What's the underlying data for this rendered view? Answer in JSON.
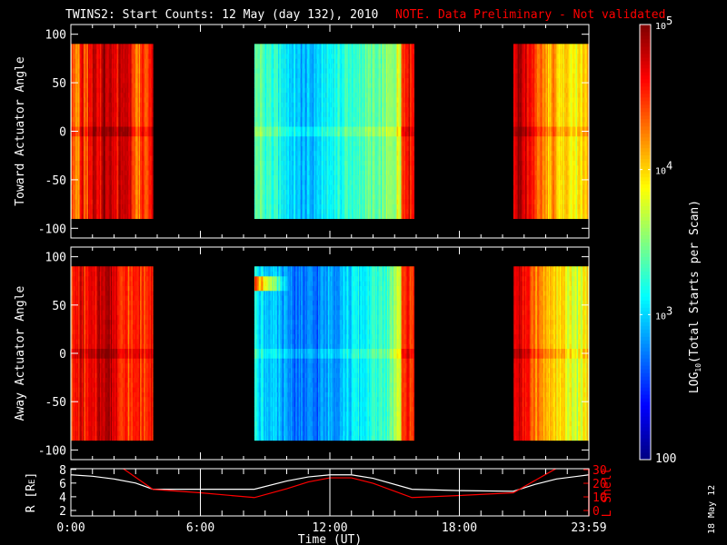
{
  "chart_data": {
    "type": "heatmap",
    "title": "TWINS2: Start Counts: 12 May (day 132), 2010",
    "note": "NOTE. Data Preliminary - Not validated",
    "colors": {
      "note": "#ff0000",
      "axis": "#ffffff",
      "lshell": "#ff0000",
      "r_line": "#ffffff"
    },
    "xlabel": "Time (UT)",
    "xlim_hours": [
      0,
      24
    ],
    "xticks": [
      {
        "h": 0,
        "label": "0:00"
      },
      {
        "h": 6,
        "label": "6:00"
      },
      {
        "h": 12,
        "label": "12:00"
      },
      {
        "h": 18,
        "label": "18:00"
      },
      {
        "h": 24,
        "label": "23:59"
      }
    ],
    "colorbar": {
      "label_prefix": "LOG",
      "label_sub": "10",
      "label_suffix": "(Total Starts per Scan)",
      "range_log": [
        2,
        5
      ],
      "ticks": [
        {
          "v": 2,
          "label": "100"
        },
        {
          "v": 3,
          "base": "10",
          "exp": "3"
        },
        {
          "v": 4,
          "base": "10",
          "exp": "4"
        },
        {
          "v": 5,
          "base": "10",
          "exp": "5"
        }
      ]
    },
    "panels": [
      {
        "ylabel": "Toward Actuator Angle",
        "ylim": [
          -110,
          110
        ],
        "yticks": [
          {
            "v": 100,
            "label": "100"
          },
          {
            "v": 50,
            "label": "50"
          },
          {
            "v": 0,
            "label": "0"
          },
          {
            "v": -50,
            "label": "-50"
          },
          {
            "v": -100,
            "label": "-100"
          }
        ],
        "angle_range": [
          -90,
          90
        ],
        "step_hours": 0.2,
        "blocks": [
          {
            "start": 0.0,
            "values": [
              4.4,
              4.2,
              4.6,
              4.3,
              4.6,
              4.8,
              4.7,
              4.9,
              4.8,
              4.7,
              4.6,
              4.8,
              4.9,
              4.7,
              4.5,
              4.3,
              4.6,
              4.4,
              4.7
            ]
          },
          {
            "start": 8.5,
            "values": [
              3.4,
              3.4,
              3.3,
              3.3,
              3.2,
              3.2,
              3.1,
              3.1,
              3.0,
              3.0,
              2.9,
              2.9,
              2.9,
              2.9,
              3.0,
              3.0,
              3.1,
              3.1,
              3.2,
              3.2,
              3.2,
              3.3,
              3.3,
              3.2,
              3.3,
              3.4,
              3.4,
              3.4,
              3.3,
              3.4,
              3.5,
              3.5,
              3.6,
              3.8,
              4.5,
              4.7,
              4.6
            ]
          },
          {
            "start": 20.5,
            "values": [
              4.8,
              4.9,
              4.7,
              4.6,
              4.5,
              4.4,
              4.3,
              4.2,
              4.1,
              4.2,
              4.0,
              3.9,
              4.0,
              3.9,
              3.8,
              3.9,
              4.0,
              4.1
            ]
          }
        ]
      },
      {
        "ylabel": "Away Actuator Angle",
        "ylim": [
          -110,
          110
        ],
        "yticks": [
          {
            "v": 100,
            "label": "100"
          },
          {
            "v": 50,
            "label": "50"
          },
          {
            "v": 0,
            "label": "0"
          },
          {
            "v": -50,
            "label": "-50"
          },
          {
            "v": -100,
            "label": "-100"
          }
        ],
        "angle_range": [
          -90,
          90
        ],
        "step_hours": 0.2,
        "blocks": [
          {
            "start": 0.0,
            "values": [
              4.5,
              4.6,
              4.7,
              4.5,
              4.6,
              4.7,
              4.8,
              4.9,
              4.9,
              4.8,
              4.7,
              4.6,
              4.5,
              4.4,
              4.5,
              4.6,
              4.5,
              4.4,
              4.6
            ]
          },
          {
            "start": 8.5,
            "values": [
              3.2,
              3.1,
              3.0,
              3.0,
              2.9,
              2.9,
              2.8,
              2.8,
              2.8,
              2.7,
              2.7,
              2.7,
              2.7,
              2.7,
              2.7,
              2.8,
              2.8,
              2.9,
              2.9,
              2.9,
              3.0,
              3.0,
              3.0,
              3.1,
              3.1,
              3.1,
              3.2,
              3.2,
              3.2,
              3.3,
              3.3,
              3.4,
              3.5,
              3.8,
              4.4,
              4.6,
              4.5
            ]
          },
          {
            "start": 20.5,
            "values": [
              4.7,
              4.8,
              4.6,
              4.5,
              4.4,
              4.3,
              4.2,
              4.1,
              4.0,
              4.0,
              3.9,
              3.9,
              3.8,
              3.8,
              3.7,
              3.8,
              3.9,
              4.0
            ]
          }
        ]
      }
    ],
    "orbit": {
      "left_label": "R [R",
      "left_label_sub": "E",
      "right_label": "L Shell",
      "left_ylim": [
        1.2,
        8.1
      ],
      "right_ylim": [
        -4,
        30.7
      ],
      "left_ticks": [
        {
          "v": 2,
          "label": "2"
        },
        {
          "v": 4,
          "label": "4"
        },
        {
          "v": 6,
          "label": "6"
        },
        {
          "v": 8,
          "label": "8"
        }
      ],
      "right_ticks": [
        {
          "v": 0,
          "label": "0"
        },
        {
          "v": 10,
          "label": "10"
        },
        {
          "v": 20,
          "label": "20"
        },
        {
          "v": 30,
          "label": "30"
        }
      ],
      "r_series": {
        "hours": [
          0,
          1,
          2,
          3,
          3.8,
          6,
          8.5,
          10,
          11,
          12,
          13,
          14,
          15.8,
          18,
          20.5,
          21.5,
          22.5,
          24
        ],
        "values": [
          7.2,
          7.0,
          6.6,
          6.0,
          5.1,
          5.1,
          5.1,
          6.3,
          6.9,
          7.2,
          7.2,
          6.7,
          5.1,
          4.9,
          4.8,
          5.8,
          6.6,
          7.2
        ]
      },
      "l_series": {
        "hours": [
          2.4,
          3.8,
          6,
          8.5,
          10,
          11,
          12,
          13,
          14,
          15.8,
          18,
          20.5,
          21.5,
          22.5
        ],
        "values": [
          31,
          15.5,
          13,
          9.5,
          16,
          21,
          24,
          24,
          20,
          9.5,
          11,
          13,
          22,
          31
        ]
      }
    },
    "date_stamp": "18 May 12"
  }
}
